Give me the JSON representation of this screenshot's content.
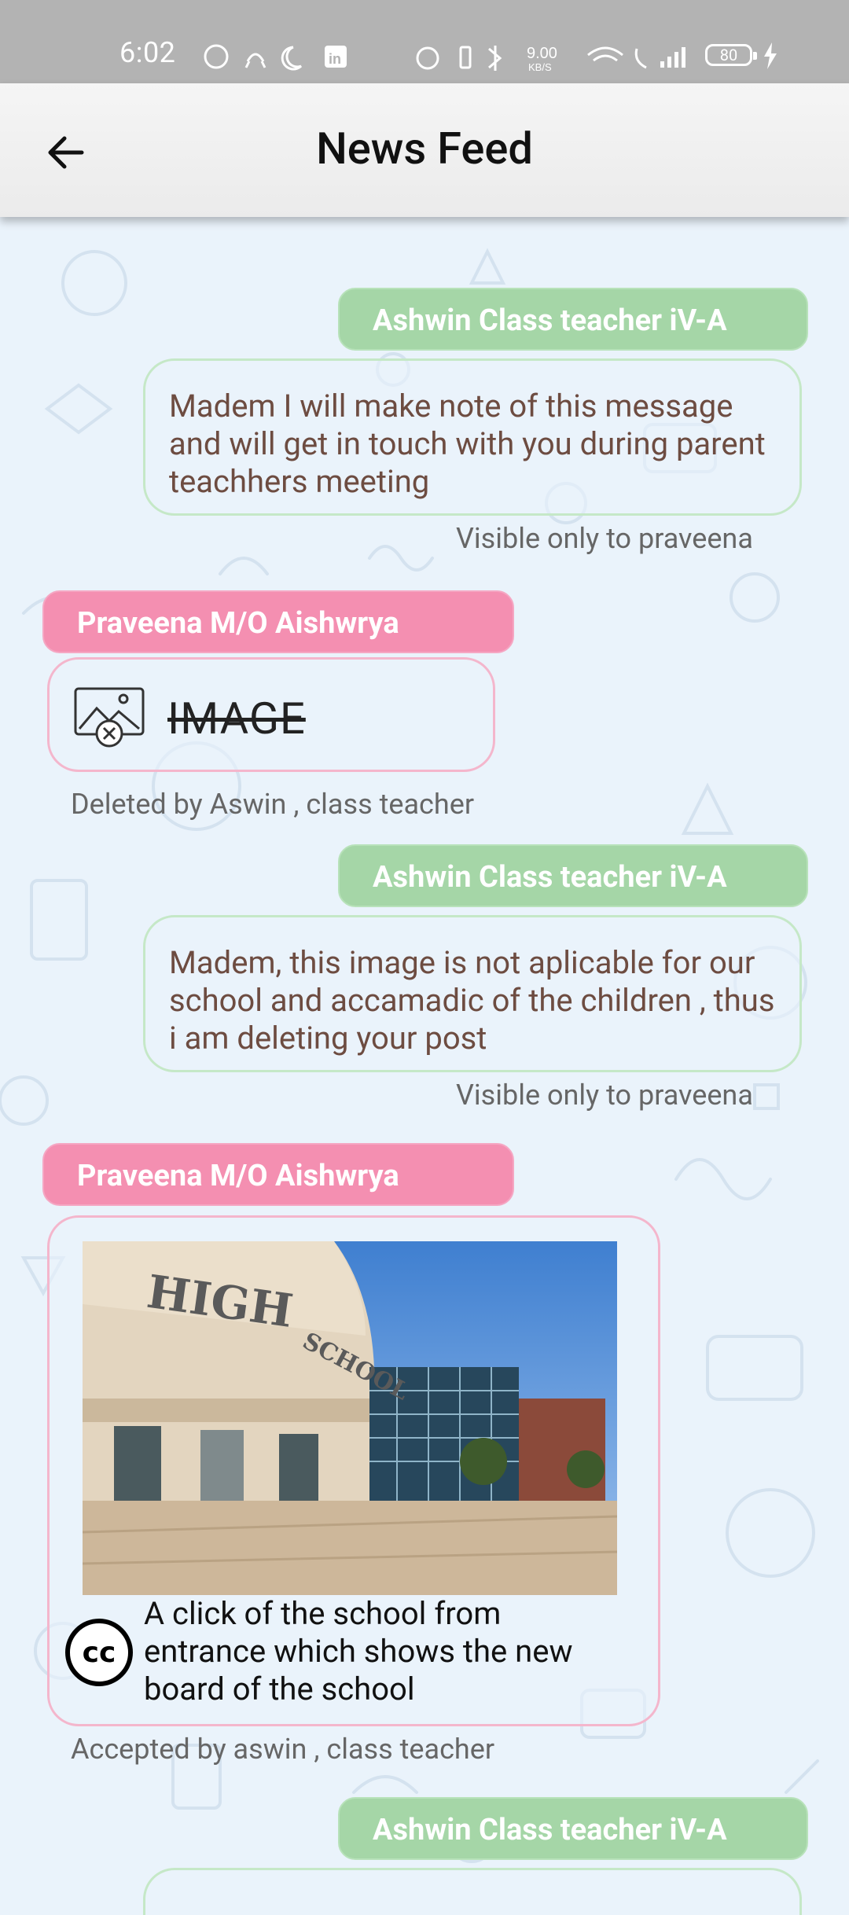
{
  "status_bar": {
    "time": "6:02",
    "net_speed": "9.00",
    "net_unit": "KB/S",
    "battery": "80"
  },
  "app_bar": {
    "title": "News Feed",
    "back_icon": "arrow-back-icon"
  },
  "feed": [
    {
      "sender": "Ashwin Class teacher iV-A",
      "role": "teacher",
      "message": " Madem I will make note of this message and will get in touch with you during parent teachhers meeting",
      "note": "Visible only to praveena"
    },
    {
      "sender": "Praveena M/O Aishwrya",
      "role": "parent",
      "deleted_label": "IMAGE",
      "note": "Deleted by Aswin , class teacher"
    },
    {
      "sender": "Ashwin Class teacher iV-A",
      "role": "teacher",
      "message": " Madem, this image is not aplicable for our school and accamadic of the children , thus i am deleting your post",
      "note": "Visible only to praveena"
    },
    {
      "sender": "Praveena M/O Aishwrya",
      "role": "parent",
      "photo_text": [
        "HIGH",
        "SCHOOL"
      ],
      "caption": "A click of the school from entrance which shows the new board of the school",
      "caption_icon": "cc-icon",
      "note": "Accepted by aswin , class teacher"
    },
    {
      "sender": "Ashwin Class teacher iV-A",
      "role": "teacher"
    }
  ],
  "colors": {
    "teacher_tag": "#a5d6a7",
    "parent_tag": "#f48fb1",
    "message_text": "#6d4c41",
    "background": "#eaf3fb"
  }
}
